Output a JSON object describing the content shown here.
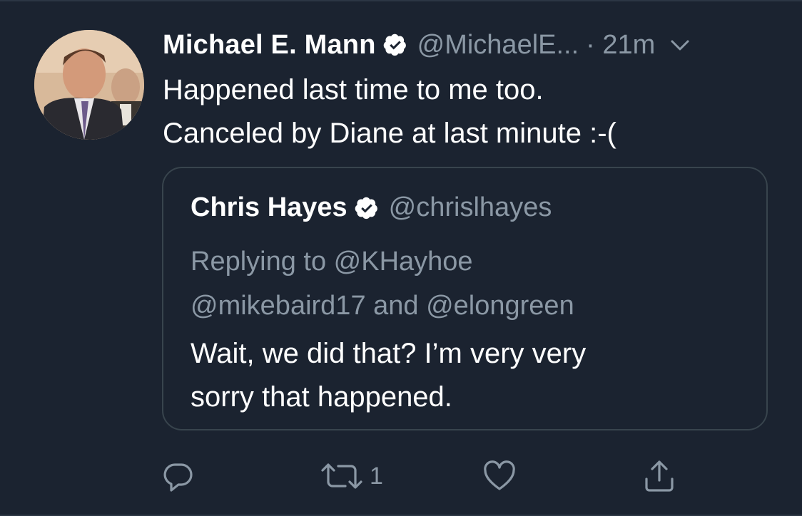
{
  "tweet": {
    "author_name": "Michael E. Mann",
    "author_handle": "@MichaelE...",
    "time": "· 21m",
    "text_lines": [
      "Happened last time to me too.",
      "Canceled by Diane at last minute :-("
    ]
  },
  "quoted_tweet": {
    "author_name": "Chris Hayes",
    "author_handle": "@chrislhayes",
    "reply_lines": [
      "Replying to @KHayhoe",
      "@mikebaird17 and @elongreen"
    ],
    "text_lines": [
      "Wait, we did that? I’m very very",
      "sorry that happened."
    ]
  },
  "actions": {
    "reply_count": "",
    "retweet_count": "1",
    "like_count": "",
    "icons": [
      "reply-icon",
      "retweet-icon",
      "like-icon",
      "share-icon"
    ]
  },
  "colors": {
    "background": "#1b2330",
    "text": "#ffffff",
    "muted": "#8b98a5",
    "border": "#38444d"
  }
}
